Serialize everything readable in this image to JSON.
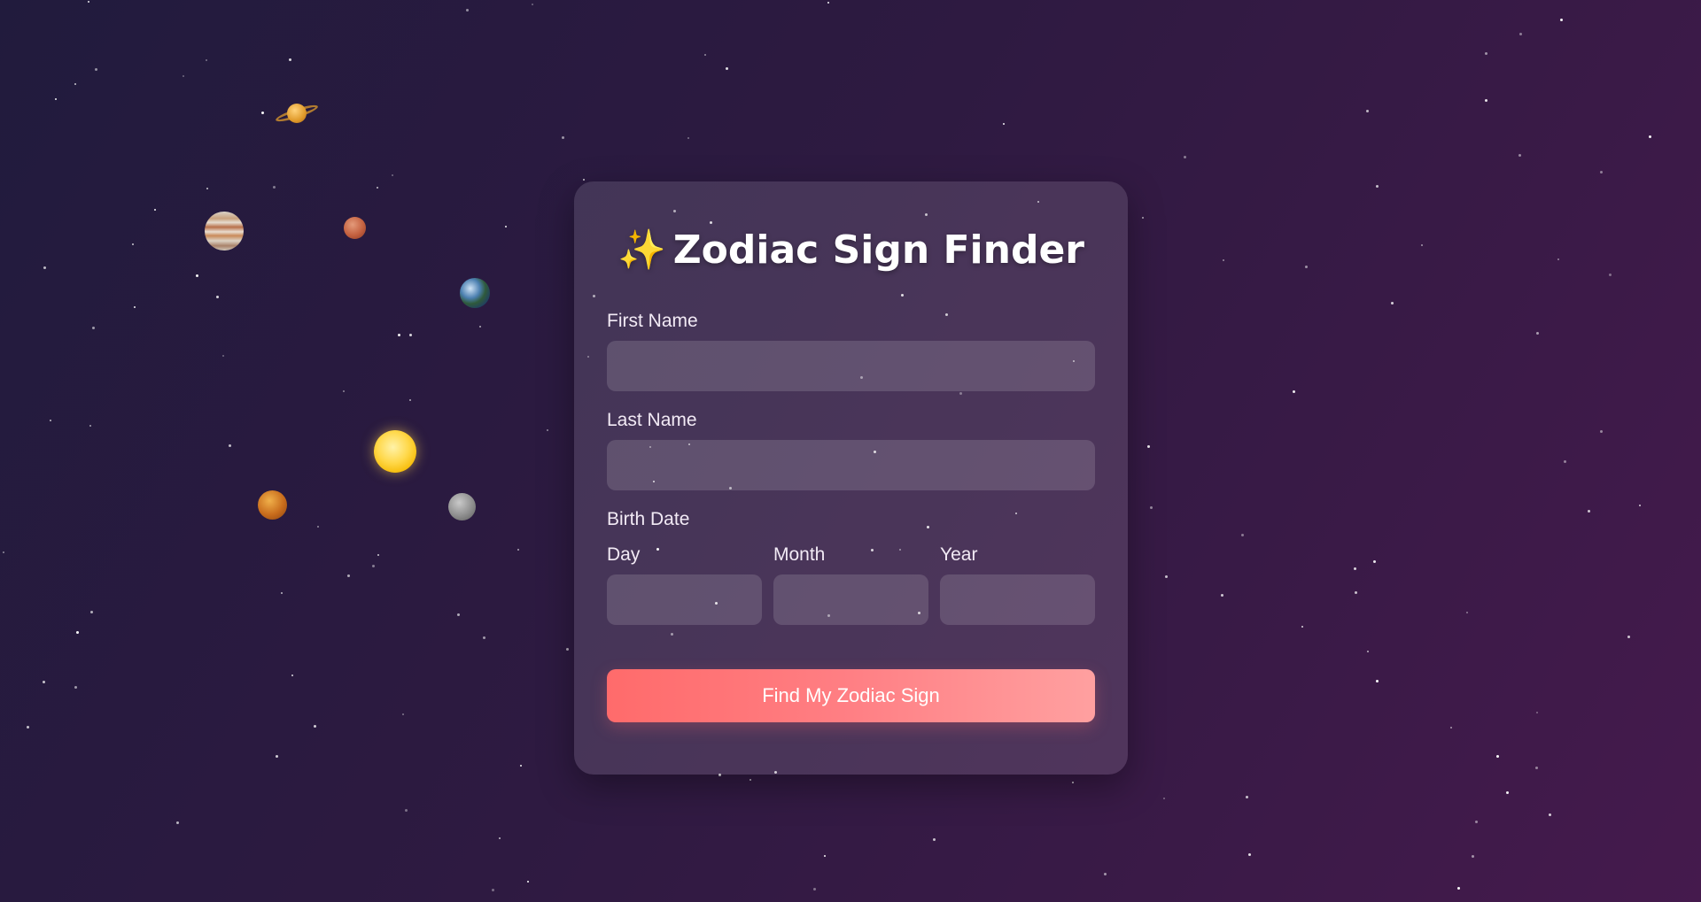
{
  "header": {
    "title_icon": "sparkles-icon",
    "title_emoji": "✨",
    "title": "Zodiac Sign Finder"
  },
  "form": {
    "first_name": {
      "label": "First Name",
      "value": "",
      "placeholder": ""
    },
    "last_name": {
      "label": "Last Name",
      "value": "",
      "placeholder": ""
    },
    "birth_date": {
      "label": "Birth Date",
      "day": {
        "label": "Day",
        "value": "",
        "placeholder": ""
      },
      "month": {
        "label": "Month",
        "value": "",
        "placeholder": ""
      },
      "year": {
        "label": "Year",
        "value": "",
        "placeholder": ""
      }
    },
    "submit_label": "Find My Zodiac Sign"
  },
  "decorations": {
    "planets": [
      "saturn-icon",
      "jupiter-icon",
      "mars-icon",
      "earth-icon",
      "sun-icon",
      "venus-icon",
      "mercury-icon"
    ]
  },
  "colors": {
    "accent_start": "#ff6b6b",
    "accent_end": "#ffa0a0",
    "background_start": "#211b3d",
    "background_end": "#451a4d"
  }
}
